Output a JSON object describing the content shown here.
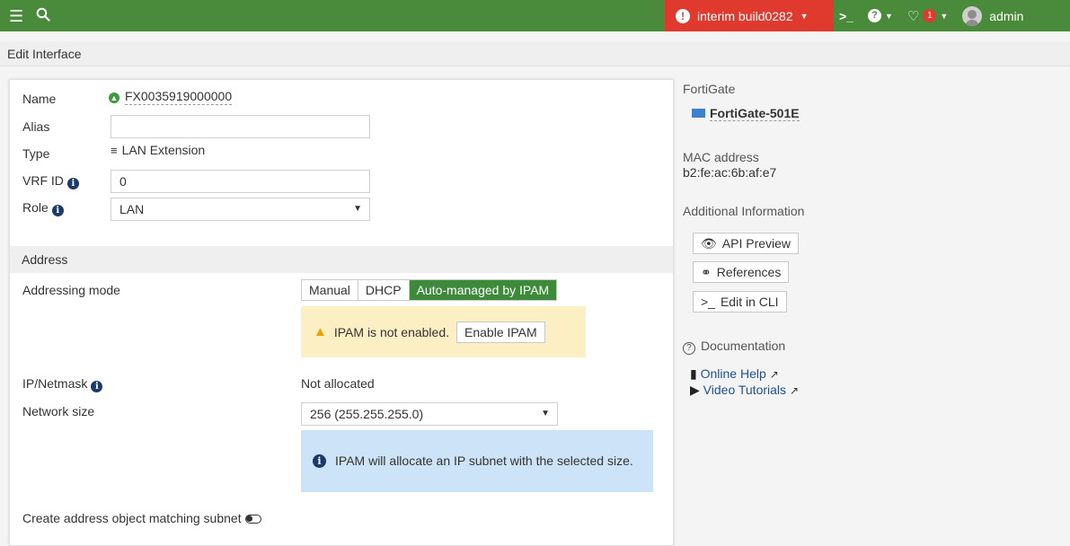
{
  "topbar": {
    "build_label": "interim build0282",
    "user": "admin"
  },
  "page": {
    "title": "Edit Interface"
  },
  "form": {
    "name_label": "Name",
    "name_value": "FX0035919000000",
    "alias_label": "Alias",
    "alias_value": "",
    "type_label": "Type",
    "type_value": "LAN Extension",
    "vrf_label": "VRF ID",
    "vrf_value": "0",
    "role_label": "Role",
    "role_value": "LAN"
  },
  "address": {
    "section_title": "Address",
    "addressing_mode_label": "Addressing mode",
    "modes": [
      "Manual",
      "DHCP",
      "Auto-managed by IPAM"
    ],
    "selected_mode": "Auto-managed by IPAM",
    "ipam_warning": "IPAM is not enabled.",
    "enable_ipam_button": "Enable IPAM",
    "ip_netmask_label": "IP/Netmask",
    "ip_netmask_value": "Not allocated",
    "network_size_label": "Network size",
    "network_size_value": "256 (255.255.255.0)",
    "ipam_info": "IPAM will allocate an IP subnet with the selected size.",
    "create_address_label": "Create address object matching subnet",
    "create_address_enabled": false
  },
  "sidebar": {
    "fortigate_heading": "FortiGate",
    "device_name": "FortiGate-501E",
    "mac_heading": "MAC address",
    "mac_value": "b2:fe:ac:6b:af:e7",
    "additional_info_heading": "Additional Information",
    "api_preview_button": "API Preview",
    "references_button": "References",
    "edit_cli_button": "Edit in CLI",
    "documentation_heading": "Documentation",
    "online_help_link": "Online Help",
    "video_tutorials_link": "Video Tutorials"
  },
  "colors": {
    "topbar_green": "#4a8a3b",
    "build_red": "#e03a2f",
    "active_segment": "#3d8b3a",
    "warning_bg": "#fcefc3",
    "info_bg": "#cde3f7",
    "link_blue": "#1f4f99"
  }
}
